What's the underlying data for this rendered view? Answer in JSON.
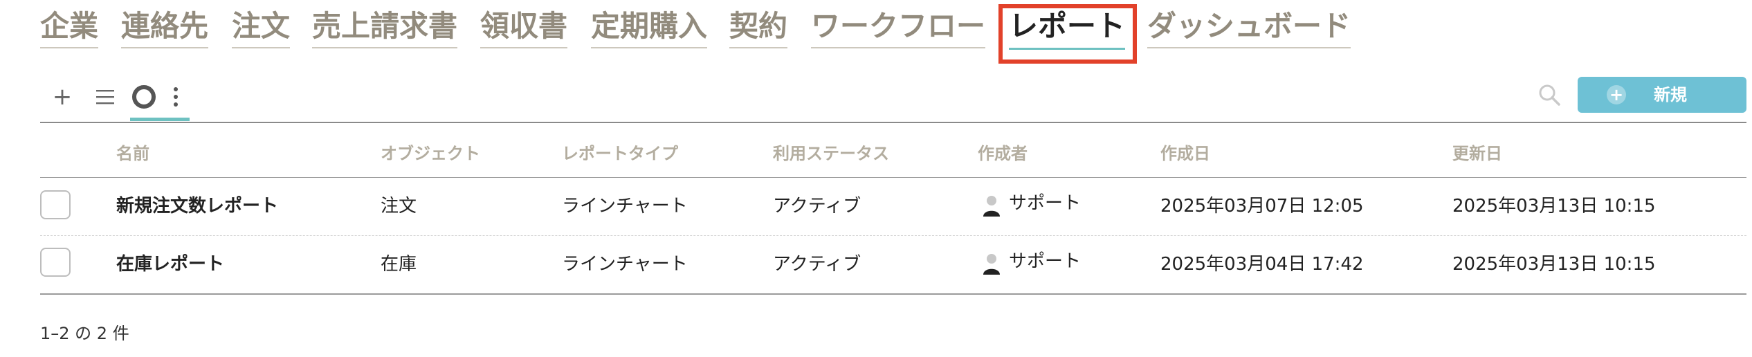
{
  "nav": {
    "items": [
      "企業",
      "連絡先",
      "注文",
      "売上請求書",
      "領収書",
      "定期購入",
      "契約",
      "ワークフロー",
      "レポート",
      "ダッシュボード"
    ],
    "active": "レポート"
  },
  "toolbar": {
    "add_icon": "plus-icon",
    "list_icon": "list-icon",
    "view_icon": "circle-icon",
    "more_icon": "more-vertical-icon",
    "search_icon": "search-icon",
    "new_label": "新規"
  },
  "table": {
    "columns": [
      "名前",
      "オブジェクト",
      "レポートタイプ",
      "利用ステータス",
      "作成者",
      "作成日",
      "更新日"
    ],
    "rows": [
      {
        "name": "新規注文数レポート",
        "object": "注文",
        "type": "ラインチャート",
        "status": "アクティブ",
        "creator": "サポート",
        "created": "2025年03月07日 12:05",
        "updated": "2025年03月13日 10:15"
      },
      {
        "name": "在庫レポート",
        "object": "在庫",
        "type": "ラインチャート",
        "status": "アクティブ",
        "creator": "サポート",
        "created": "2025年03月04日 17:42",
        "updated": "2025年03月13日 10:15"
      }
    ]
  },
  "footer": {
    "count_text": "1–2 の 2 件"
  },
  "colors": {
    "accent": "#6ec1d5",
    "highlight": "#e2412a",
    "nav_inactive": "#928b7d"
  }
}
